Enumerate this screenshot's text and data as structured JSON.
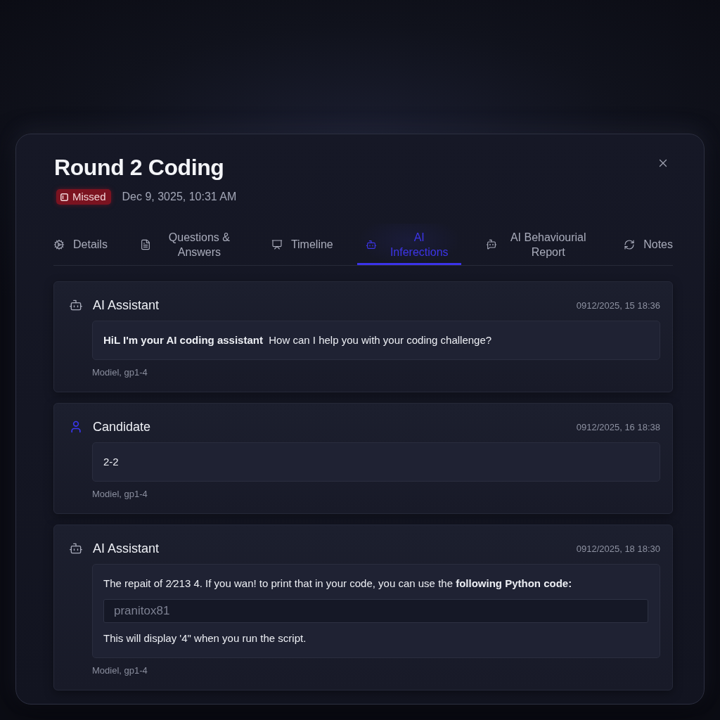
{
  "dialog": {
    "title": "Round 2 Coding",
    "status": {
      "kind": "missed",
      "label": "Missed"
    },
    "date": "Dec 9, 3025, 10:31 AM"
  },
  "tabs": [
    {
      "label": "Details",
      "selected": false
    },
    {
      "label": "Questions & Answers",
      "selected": false
    },
    {
      "label": "Timeline",
      "selected": false
    },
    {
      "label": "AI Inferections",
      "selected": true
    },
    {
      "label": "AI Behaviourial Report",
      "selected": false
    },
    {
      "label": "Notes",
      "selected": false
    }
  ],
  "messages": [
    {
      "kind": "assistant",
      "author": "AI Assistant",
      "time": "0912/2025, 15 18:36",
      "body": [
        {
          "kind": "text",
          "text": "**HiL I'm your AI coding assistant**  How can I help you with your coding challenge?"
        }
      ],
      "model": "Modiel, gp1-4"
    },
    {
      "kind": "candidate",
      "author": "Candidate",
      "time": "0912/2025, 16 18:38",
      "body": [
        {
          "kind": "text",
          "text": "2-2"
        }
      ],
      "model": "Modiel, gp1-4"
    },
    {
      "kind": "assistant",
      "author": "AI Assistant",
      "time": "0912/2025, 18 18:30",
      "body": [
        {
          "kind": "text",
          "text": "The repait of 2⁄213 4. If you wan! to print that in your code, you can use the **following Python code:**"
        },
        {
          "kind": "code",
          "text": "pranitox81"
        },
        {
          "kind": "text",
          "text": "This will display '4\" when you run the script."
        }
      ],
      "model": "Modiel, gp1-4"
    }
  ]
}
